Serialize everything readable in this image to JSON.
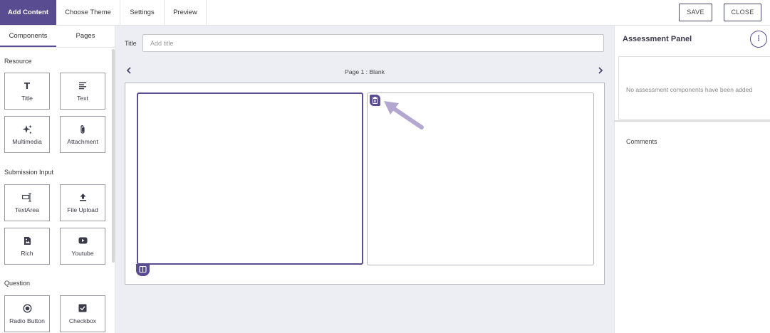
{
  "topbar": {
    "tabs": [
      {
        "label": "Add Content",
        "active": true
      },
      {
        "label": "Choose Theme",
        "active": false
      },
      {
        "label": "Settings",
        "active": false
      },
      {
        "label": "Preview",
        "active": false
      }
    ],
    "save_label": "SAVE",
    "close_label": "CLOSE"
  },
  "sidebar": {
    "tabs": [
      {
        "label": "Components",
        "active": true
      },
      {
        "label": "Pages",
        "active": false
      }
    ],
    "sections": [
      {
        "heading": "Resource",
        "items": [
          {
            "label": "Title",
            "icon": "title-T-icon"
          },
          {
            "label": "Text",
            "icon": "text-lines-icon"
          },
          {
            "label": "Multimedia",
            "icon": "sparkle-icon"
          },
          {
            "label": "Attachment",
            "icon": "paperclip-icon"
          }
        ]
      },
      {
        "heading": "Submission Input",
        "items": [
          {
            "label": "TextArea",
            "icon": "textarea-cursor-icon"
          },
          {
            "label": "File Upload",
            "icon": "upload-icon"
          },
          {
            "label": "Rich",
            "icon": "rich-image-icon"
          },
          {
            "label": "Youtube",
            "icon": "youtube-play-icon"
          }
        ]
      },
      {
        "heading": "Question",
        "items": [
          {
            "label": "Radio Button",
            "icon": "radio-icon"
          },
          {
            "label": "Checkbox",
            "icon": "checkbox-icon"
          }
        ]
      }
    ]
  },
  "main": {
    "title_label": "Title",
    "title_placeholder": "Add title",
    "page_label": "Page 1 : Blank"
  },
  "panel": {
    "title": "Assessment Panel",
    "empty_message": "No assessment components have been added",
    "comments_label": "Comments"
  },
  "colors": {
    "accent": "#5a4c91",
    "arrow": "#b3a6cf",
    "canvas_bg": "#eceef3"
  }
}
